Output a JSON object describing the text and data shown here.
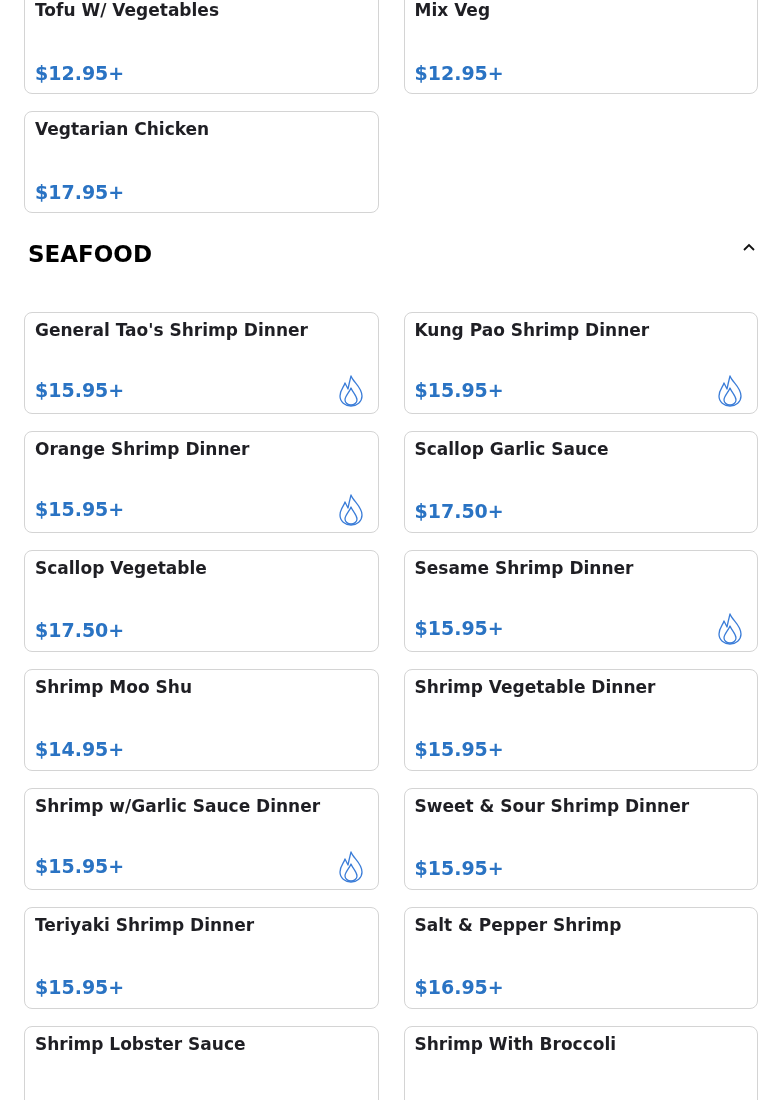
{
  "sections": [
    {
      "items": [
        {
          "name": "Tofu W/ Vegetables",
          "price": "$12.95+",
          "spicy": false
        },
        {
          "name": "Mix Veg",
          "price": "$12.95+",
          "spicy": false
        },
        {
          "name": "Vegtarian Chicken",
          "price": "$17.95+",
          "spicy": false
        }
      ]
    },
    {
      "title": "SEAFOOD",
      "expanded": true,
      "items": [
        {
          "name": "General Tao's Shrimp Dinner",
          "price": "$15.95+",
          "spicy": true
        },
        {
          "name": "Kung Pao Shrimp Dinner",
          "price": "$15.95+",
          "spicy": true
        },
        {
          "name": "Orange Shrimp Dinner",
          "price": "$15.95+",
          "spicy": true
        },
        {
          "name": "Scallop Garlic Sauce",
          "price": "$17.50+",
          "spicy": false
        },
        {
          "name": "Scallop Vegetable",
          "price": "$17.50+",
          "spicy": false
        },
        {
          "name": "Sesame Shrimp Dinner",
          "price": "$15.95+",
          "spicy": true
        },
        {
          "name": "Shrimp Moo Shu",
          "price": "$14.95+",
          "spicy": false
        },
        {
          "name": "Shrimp Vegetable Dinner",
          "price": "$15.95+",
          "spicy": false
        },
        {
          "name": "Shrimp w/Garlic Sauce Dinner",
          "price": "$15.95+",
          "spicy": true
        },
        {
          "name": "Sweet & Sour Shrimp Dinner",
          "price": "$15.95+",
          "spicy": false
        },
        {
          "name": "Teriyaki Shrimp Dinner",
          "price": "$15.95+",
          "spicy": false
        },
        {
          "name": "Salt & Pepper Shrimp",
          "price": "$16.95+",
          "spicy": false
        },
        {
          "name": "Shrimp Lobster Sauce",
          "spicy": false
        },
        {
          "name": "Shrimp With Broccoli",
          "spicy": false
        }
      ]
    }
  ]
}
